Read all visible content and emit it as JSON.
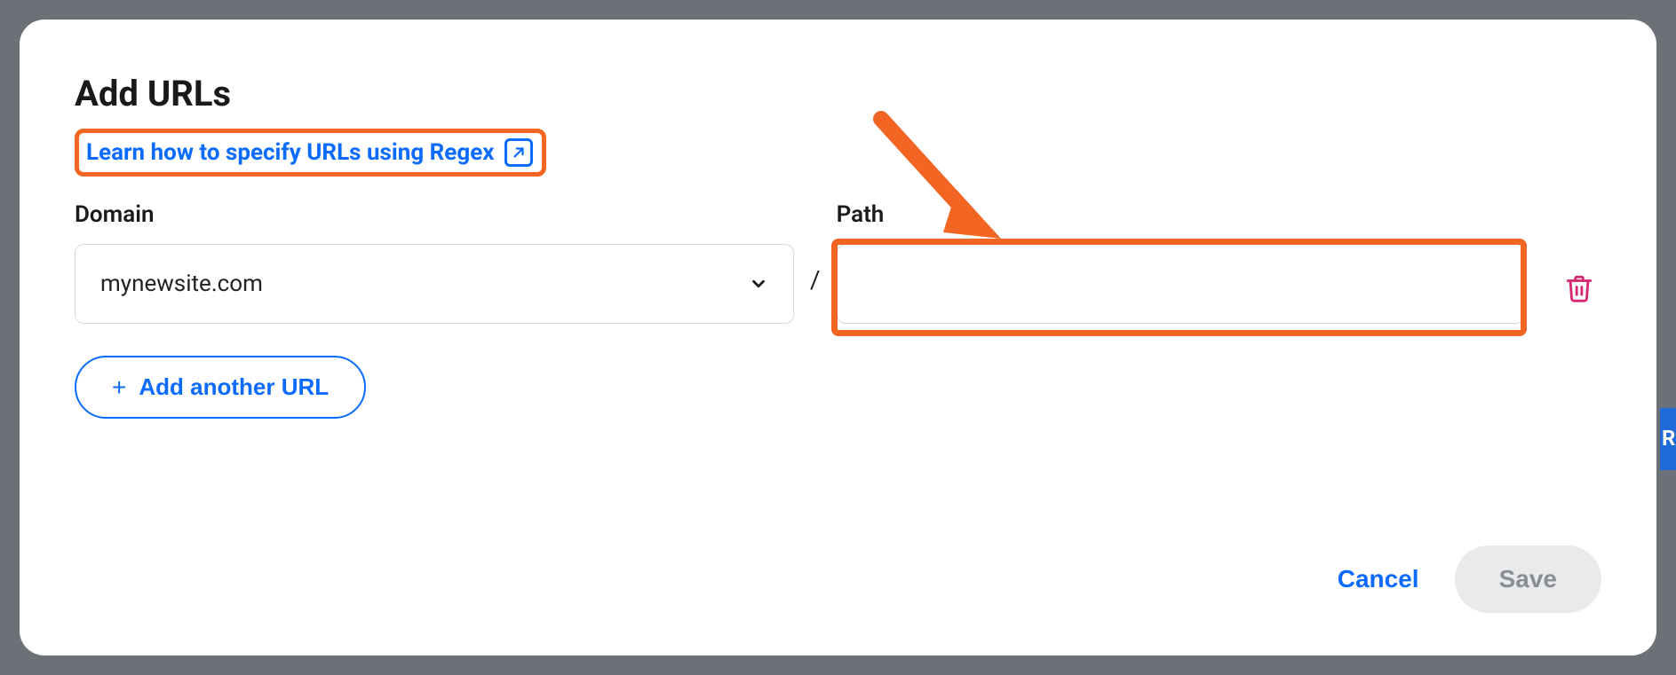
{
  "modal": {
    "title": "Add URLs",
    "regex_link_label": "Learn how to specify URLs using Regex",
    "domain_label": "Domain",
    "path_label": "Path",
    "separator": "/",
    "domain_value": "mynewsite.com",
    "path_value": "",
    "add_another_label": "Add another URL",
    "cancel_label": "Cancel",
    "save_label": "Save"
  },
  "annotations": {
    "highlight_regex_link": true,
    "highlight_path_input": true,
    "arrow_to_path": true
  },
  "background_fragment": "R"
}
